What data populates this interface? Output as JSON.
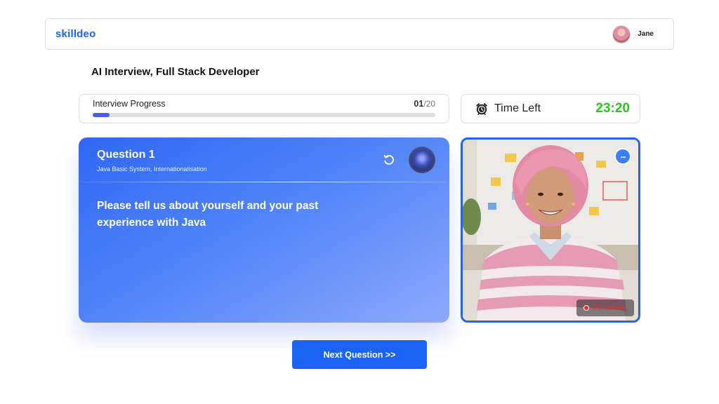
{
  "header": {
    "logo": "skilldeo",
    "user_name": "Jane"
  },
  "page_title": "AI Interview, Full Stack Developer",
  "progress": {
    "label": "Interview Progress",
    "current": "01",
    "total": "/20",
    "fraction": 0.05
  },
  "timer": {
    "label": "Time Left",
    "value": "23:20"
  },
  "question": {
    "title": "Question 1",
    "subtitle": "Java Basic System, Internationalisation",
    "text": "Please tell us about yourself and your past experience with Java"
  },
  "video": {
    "recording_label": "Recording"
  },
  "actions": {
    "next_label": "Next Question >>"
  },
  "colors": {
    "brand": "#1a63f5",
    "timer": "#2ec41f",
    "progress": "#4b5ce4",
    "recording": "#e53030"
  },
  "icons": [
    "avatar",
    "alarm-clock-icon",
    "replay-icon",
    "ai-orb-icon",
    "more-options-icon",
    "recording-dot-icon"
  ]
}
